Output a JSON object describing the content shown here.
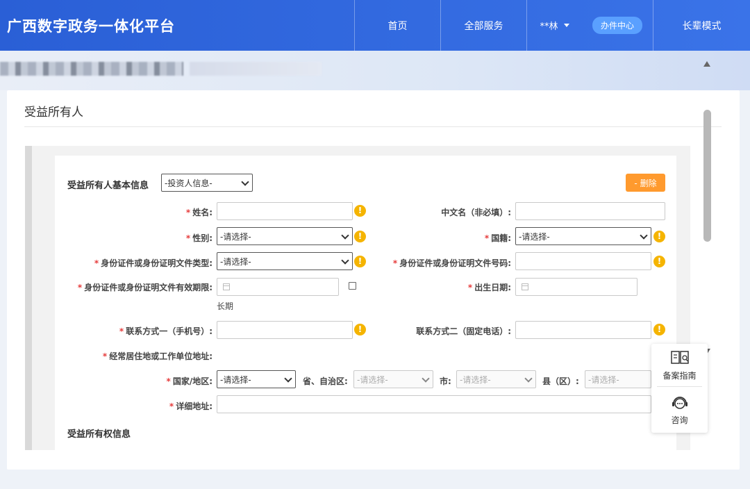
{
  "header": {
    "site_title": "广西数字政务一体化平台",
    "nav": {
      "home": "首页",
      "services": "全部服务",
      "user": "**林",
      "center": "办件中心",
      "elder_mode": "长辈模式"
    }
  },
  "page": {
    "title": "受益所有人"
  },
  "form": {
    "section_basic": "受益所有人基本信息",
    "investor_select": "-投资人信息-",
    "delete_button": "- 删除",
    "required_mark": "*",
    "fields": {
      "name": "姓名:",
      "chinese_name": "中文名（非必填）:",
      "gender": "性别:",
      "nationality": "国籍:",
      "id_type": "身份证件或身份证明文件类型:",
      "id_number": "身份证件或身份证明文件号码:",
      "id_validity": "身份证件或身份证明文件有效期限:",
      "birth_date": "出生日期:",
      "long_term": "长期",
      "phone1": "联系方式一（手机号）:",
      "phone2": "联系方式二（固定电话）:",
      "address": "经常居住地或工作单位地址:",
      "country": "国家/地区:",
      "province": "省、自治区:",
      "city": "市:",
      "county": "县（区）:",
      "detail_address": "详细地址:"
    },
    "placeholder_select": "-请选择-",
    "section_ownership": "受益所有权信息"
  },
  "float_help": {
    "guide": "备案指南",
    "consult": "咨询"
  },
  "colors": {
    "header_blue": "#2a5fd6",
    "required_red": "#e63b3b",
    "info_yellow": "#f5b400",
    "delete_orange": "#ff9a2e"
  }
}
